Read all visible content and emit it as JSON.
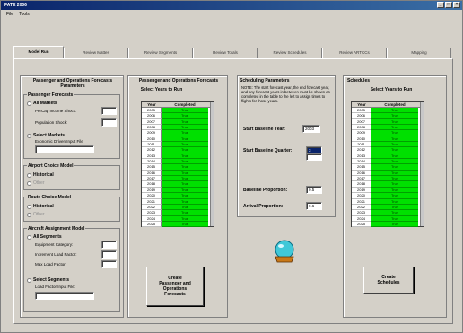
{
  "window": {
    "title": "FATE 2006",
    "min": "_",
    "max": "□",
    "close": "×"
  },
  "menu": [
    "File",
    "Tools"
  ],
  "tabs": [
    "Model Run",
    "Review Mattes",
    "Review Segments",
    "Review Totals",
    "Review Schedules",
    "Review ARTCCs",
    "Mapping"
  ],
  "left": {
    "title": "Passenger and Operations Forecasts Parameters",
    "pax_group": "Passenger Forecasts",
    "all_markets": "All Markets",
    "percap_label": "PerCap Income Shock:",
    "pop_label": "Population Shock:",
    "select_markets": "Select Markets",
    "econ_label": "Economic Driven Input File",
    "airport_group": "Airport Choice Model",
    "airport_hist": "Historical",
    "airport_other": "Other",
    "route_group": "Route Choice Model",
    "route_hist": "Historical",
    "route_other": "Other",
    "aircraft_group": "Aircraft Assignment Model",
    "all_segments": "All Segments",
    "equip_label": "Equipment Category:",
    "incr_label": "Increment Load Factor:",
    "max_label": "Max Load Factor:",
    "select_segments": "Select Segments",
    "lf_label": "Load Factor Input File:"
  },
  "pax_ops": {
    "title": "Passenger and Operations Forecasts",
    "subtitle": "Select Years to Run",
    "col_year": "Year",
    "col_completed": "Completed",
    "years": [
      "2005",
      "2006",
      "2007",
      "2008",
      "2009",
      "2010",
      "2011",
      "2012",
      "2013",
      "2014",
      "2015",
      "2016",
      "2017",
      "2018",
      "2019",
      "2020",
      "2021",
      "2022",
      "2023",
      "2024",
      "2025"
    ],
    "status": "True",
    "button": "Create\nPassenger and\nOperations\nForecasts"
  },
  "sched_params": {
    "title": "Scheduling Parameters",
    "note": "NOTE: The start forecast year, the end forecast year, and any forecast years in between must be shown as completed in the table to the left to assign times to flights for those years.",
    "start_year_label": "Start Baseline Year:",
    "start_year_value": "2003",
    "start_quarter_label": "Start Baseline Quarter:",
    "start_quarter_value": "3",
    "baseline_prop_label": "Baseline Proportion:",
    "baseline_prop_value": "0.5",
    "arrival_prop_label": "Arrival Proportion:",
    "arrival_prop_value": "0.6"
  },
  "schedules": {
    "title": "Schedules",
    "subtitle": "Select Years to Run",
    "col_year": "Year",
    "col_completed": "Completed",
    "years": [
      "2005",
      "2006",
      "2007",
      "2008",
      "2009",
      "2010",
      "2011",
      "2012",
      "2013",
      "2014",
      "2015",
      "2016",
      "2017",
      "2018",
      "2019",
      "2020",
      "2021",
      "2022",
      "2023",
      "2024",
      "2025"
    ],
    "status": "True",
    "button": "Create\nSchedules"
  },
  "colors": {
    "accent": "#0a246a",
    "completed": "#00e000",
    "globe": "#40c8d8"
  },
  "icons": [
    "crystal-ball-icon"
  ]
}
